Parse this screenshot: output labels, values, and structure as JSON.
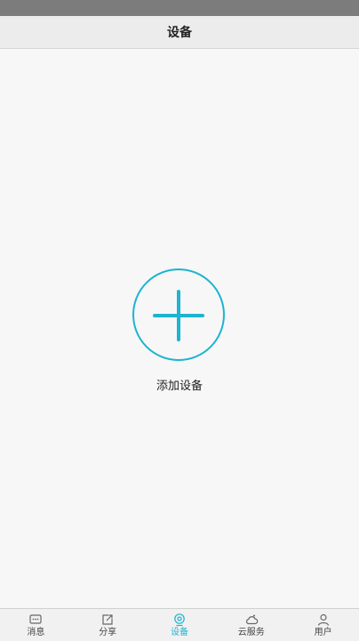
{
  "header": {
    "title": "设备"
  },
  "main": {
    "add_label": "添加设备"
  },
  "colors": {
    "accent": "#1cb4d0",
    "inactive": "#666666",
    "header_bg": "#ececec",
    "status_bar": "#7c7c7c"
  },
  "tabbar": {
    "active_index": 2,
    "items": [
      {
        "label": "消息",
        "icon": "message-icon"
      },
      {
        "label": "分享",
        "icon": "share-icon"
      },
      {
        "label": "设备",
        "icon": "device-icon"
      },
      {
        "label": "云服务",
        "icon": "cloud-icon"
      },
      {
        "label": "用户",
        "icon": "user-icon"
      }
    ]
  }
}
